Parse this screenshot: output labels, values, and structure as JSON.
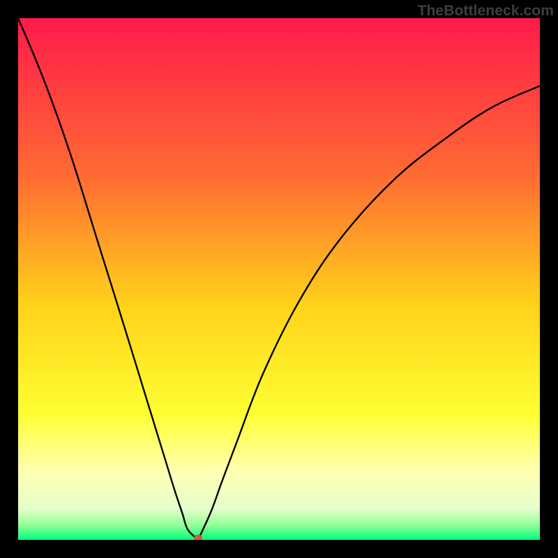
{
  "watermark": "TheBottleneck.com",
  "chart_data": {
    "type": "line",
    "title": "",
    "xlabel": "",
    "ylabel": "",
    "xlim": [
      0,
      1
    ],
    "ylim": [
      0,
      1
    ],
    "grid": false,
    "legend": false,
    "marker": {
      "x": 0.345,
      "y": 0.0,
      "color": "#cf5a42",
      "radius_px": 6
    },
    "background_gradient": {
      "stops": [
        {
          "offset": 0.0,
          "color": "#ff1a4b"
        },
        {
          "offset": 0.3,
          "color": "#ff6a33"
        },
        {
          "offset": 0.55,
          "color": "#ffd21a"
        },
        {
          "offset": 0.76,
          "color": "#ffff33"
        },
        {
          "offset": 0.87,
          "color": "#ffffb3"
        },
        {
          "offset": 0.94,
          "color": "#e6ffcc"
        },
        {
          "offset": 0.97,
          "color": "#99ff99"
        },
        {
          "offset": 1.0,
          "color": "#00ff7d"
        }
      ]
    },
    "series": [
      {
        "name": "left-branch",
        "x": [
          0.0,
          0.05,
          0.1,
          0.15,
          0.2,
          0.24,
          0.28,
          0.3,
          0.315,
          0.325,
          0.345
        ],
        "values": [
          1.0,
          0.88,
          0.74,
          0.58,
          0.42,
          0.29,
          0.16,
          0.095,
          0.05,
          0.02,
          0.0
        ]
      },
      {
        "name": "right-branch",
        "x": [
          0.345,
          0.37,
          0.39,
          0.42,
          0.47,
          0.54,
          0.62,
          0.72,
          0.82,
          0.91,
          1.0
        ],
        "values": [
          0.0,
          0.055,
          0.11,
          0.19,
          0.32,
          0.46,
          0.58,
          0.69,
          0.77,
          0.83,
          0.87
        ]
      }
    ]
  }
}
